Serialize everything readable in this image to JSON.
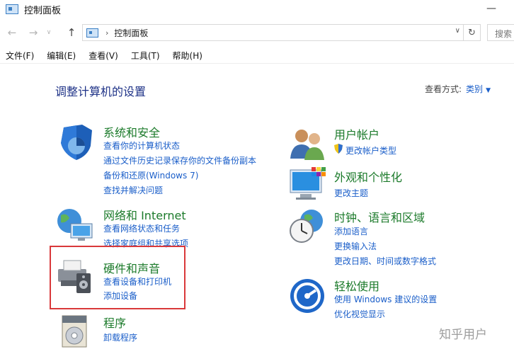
{
  "window": {
    "title": "控制面板",
    "minimize_glyph": "—"
  },
  "toolbar": {
    "back_glyph": "←",
    "forward_glyph": "→",
    "dropdown_glyph": "∨",
    "up_glyph": "↑",
    "breadcrumb_sep": "›",
    "breadcrumb": "控制面板",
    "addr_dropdown_glyph": "∨",
    "refresh_glyph": "↻",
    "search_text": "搜索"
  },
  "menu": [
    "文件(F)",
    "编辑(E)",
    "查看(V)",
    "工具(T)",
    "帮助(H)"
  ],
  "main": {
    "heading": "调整计算机的设置",
    "view_by_label": "查看方式:",
    "view_by_value": "类别",
    "view_by_caret": "▼"
  },
  "categories": {
    "system": {
      "title": "系统和安全",
      "links": [
        "查看你的计算机状态",
        "通过文件历史记录保存你的文件备份副本",
        "备份和还原(Windows 7)",
        "查找并解决问题"
      ]
    },
    "network": {
      "title": "网络和 Internet",
      "links": [
        "查看网络状态和任务",
        "选择家庭组和共享选项"
      ]
    },
    "hardware": {
      "title": "硬件和声音",
      "links": [
        "查看设备和打印机",
        "添加设备"
      ]
    },
    "programs": {
      "title": "程序",
      "links": [
        "卸载程序"
      ]
    },
    "user": {
      "title": "用户帐户",
      "links": [
        "更改帐户类型"
      ]
    },
    "appearance": {
      "title": "外观和个性化",
      "links": [
        "更改主题"
      ]
    },
    "clock": {
      "title": "时钟、语言和区域",
      "links": [
        "添加语言",
        "更换输入法",
        "更改日期、时间或数字格式"
      ]
    },
    "ease": {
      "title": "轻松使用",
      "links": [
        "使用 Windows 建议的设置",
        "优化视觉显示"
      ]
    }
  },
  "icons": {
    "system": "shield-icon",
    "network": "network-globe-icon",
    "hardware": "printer-speaker-icon",
    "programs": "programs-disc-icon",
    "user": "users-icon",
    "appearance": "monitor-palette-icon",
    "clock": "clock-globe-icon",
    "ease": "ease-of-access-icon",
    "uac": "uac-shield-icon"
  },
  "watermark": "知乎用户",
  "colors": {
    "category_title": "#1b7a2a",
    "link": "#1a5ec9",
    "heading": "#1e3287",
    "highlight": "#d9383a"
  }
}
